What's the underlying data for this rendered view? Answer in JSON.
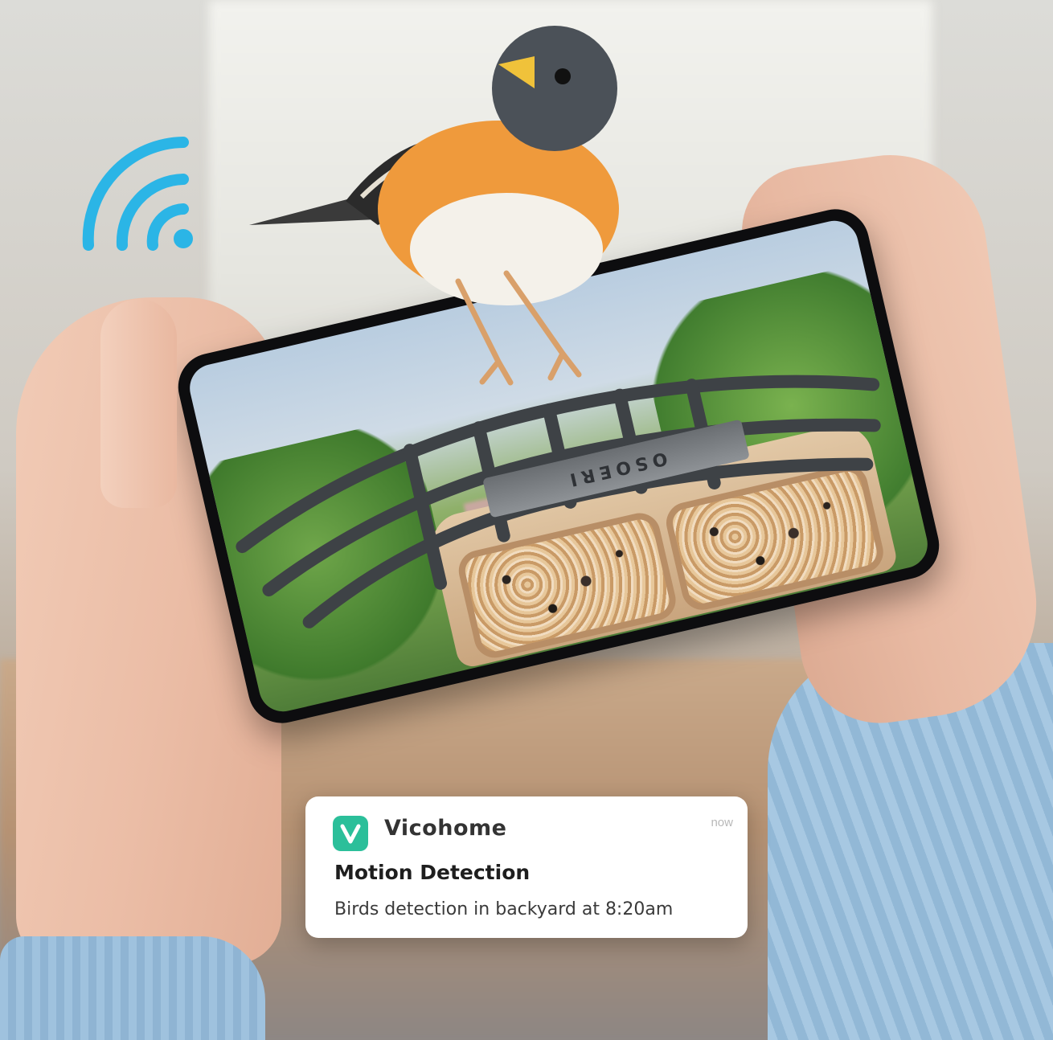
{
  "notification": {
    "app_name": "Vicohome",
    "time": "now",
    "title": "Motion Detection",
    "body": "Birds detection in backyard at 8:20am",
    "app_icon": "vicohome-logo-icon",
    "accent_color": "#2bbf9a"
  },
  "feeder": {
    "brand": "OSOERI"
  },
  "icons": {
    "wifi": "wifi-icon",
    "wifi_color": "#2bb5e6"
  }
}
